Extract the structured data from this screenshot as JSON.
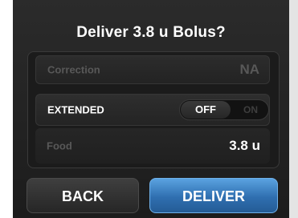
{
  "dialog": {
    "title": "Deliver 3.8 u Bolus?"
  },
  "rows": {
    "correction": {
      "label": "Correction",
      "value": "NA"
    },
    "extended": {
      "label": "EXTENDED",
      "toggle_off": "OFF",
      "toggle_on": "ON",
      "selected": "OFF"
    },
    "food": {
      "label": "Food",
      "value": "3.8 u"
    }
  },
  "buttons": {
    "back": "BACK",
    "deliver": "DELIVER"
  },
  "colors": {
    "accent": "#2f6fb0",
    "background": "#222222"
  }
}
